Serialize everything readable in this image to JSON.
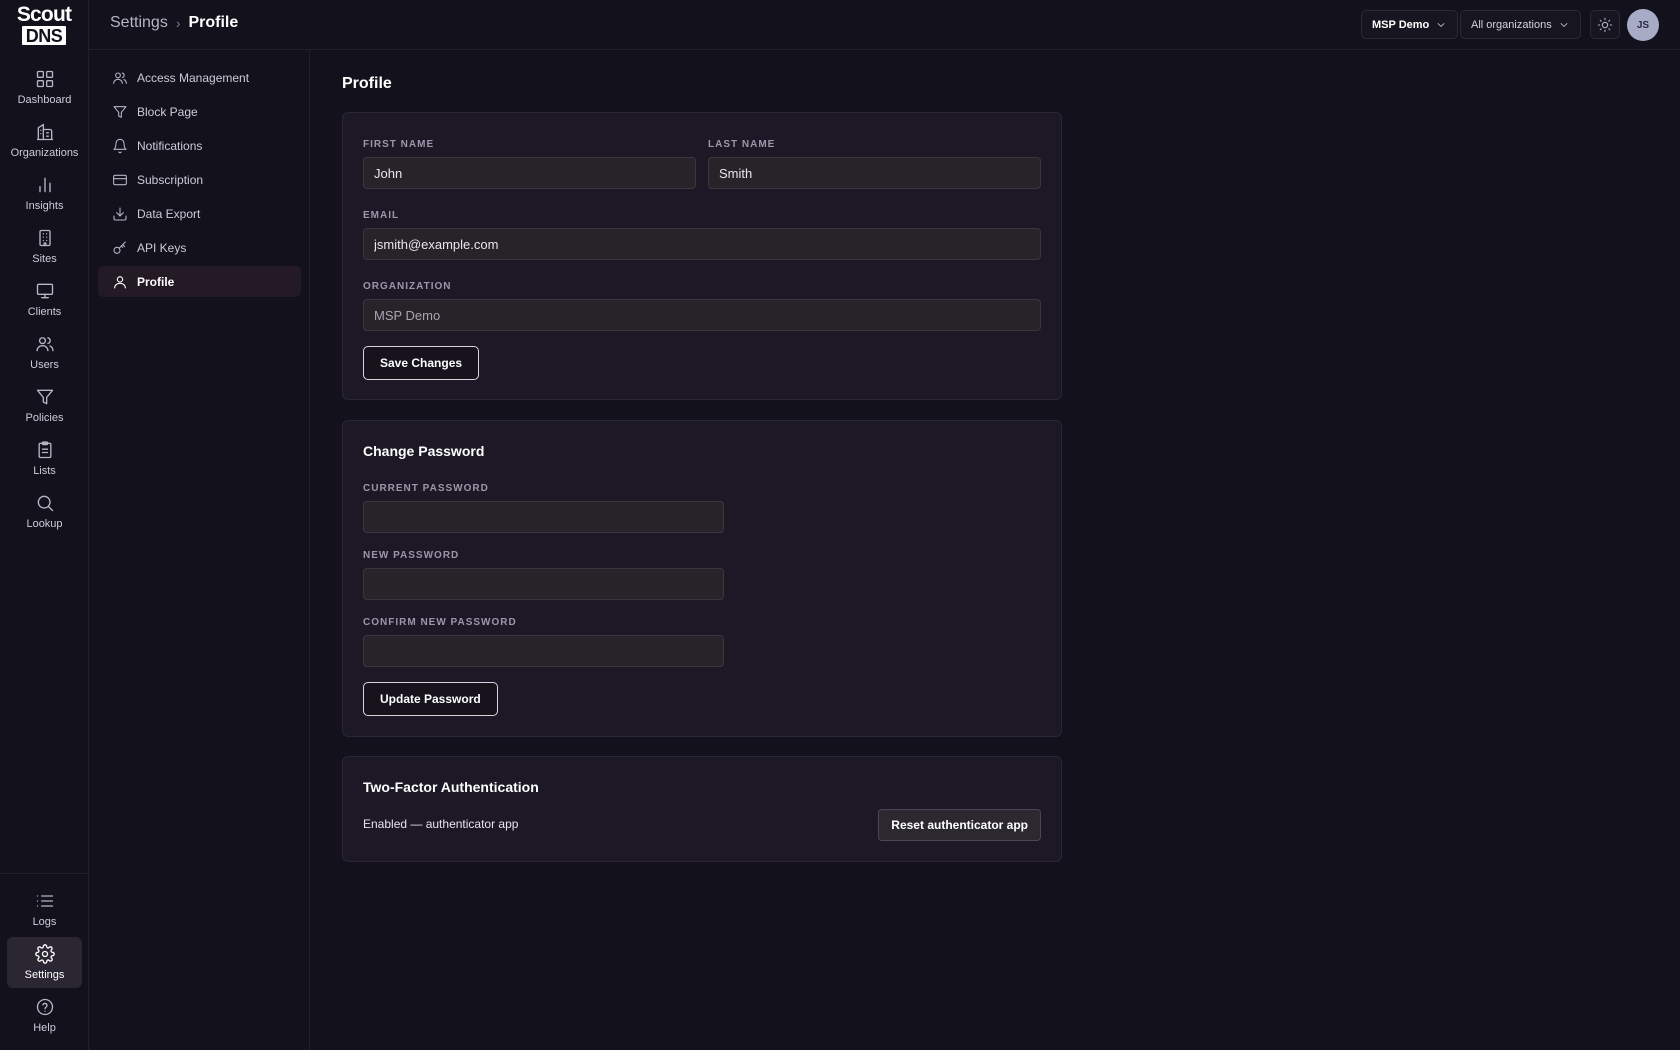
{
  "brand": {
    "line1": "Scout",
    "line2": "DNS"
  },
  "rail": {
    "items": [
      {
        "label": "Dashboard",
        "icon": "grid-icon"
      },
      {
        "label": "Organizations",
        "icon": "building-icon"
      },
      {
        "label": "Insights",
        "icon": "bar-chart-icon"
      },
      {
        "label": "Sites",
        "icon": "office-icon"
      },
      {
        "label": "Clients",
        "icon": "monitor-icon"
      },
      {
        "label": "Users",
        "icon": "users-icon"
      },
      {
        "label": "Policies",
        "icon": "filter-icon"
      },
      {
        "label": "Lists",
        "icon": "clipboard-icon"
      },
      {
        "label": "Lookup",
        "icon": "search-icon"
      }
    ],
    "bottom_items": [
      {
        "label": "Logs",
        "icon": "list-icon"
      },
      {
        "label": "Settings",
        "icon": "gear-icon",
        "active": true
      },
      {
        "label": "Help",
        "icon": "help-icon"
      }
    ]
  },
  "header": {
    "breadcrumb_parent": "Settings",
    "breadcrumb_separator": "›",
    "breadcrumb_current": "Profile",
    "org_selector": "MSP Demo",
    "scope_selector": "All organizations",
    "theme_icon": "sun-icon",
    "avatar_initials": "JS"
  },
  "settings_nav": {
    "items": [
      {
        "label": "Access Management",
        "icon": "users-icon"
      },
      {
        "label": "Block Page",
        "icon": "filter-icon"
      },
      {
        "label": "Notifications",
        "icon": "bell-icon"
      },
      {
        "label": "Subscription",
        "icon": "credit-card-icon"
      },
      {
        "label": "Data Export",
        "icon": "download-icon"
      },
      {
        "label": "API Keys",
        "icon": "key-icon"
      },
      {
        "label": "Profile",
        "icon": "user-icon",
        "active": true
      }
    ]
  },
  "profile": {
    "title": "Profile",
    "first_name_label": "FIRST NAME",
    "first_name_value": "John",
    "last_name_label": "LAST NAME",
    "last_name_value": "Smith",
    "email_label": "EMAIL",
    "email_value": "jsmith@example.com",
    "organization_label": "ORGANIZATION",
    "organization_value": "MSP Demo",
    "save_button": "Save Changes"
  },
  "password": {
    "title": "Change Password",
    "current_label": "CURRENT PASSWORD",
    "new_label": "NEW PASSWORD",
    "confirm_label": "CONFIRM NEW PASSWORD",
    "update_button": "Update Password"
  },
  "twofa": {
    "title": "Two-Factor Authentication",
    "status": "Enabled — authenticator app",
    "reset_button": "Reset authenticator app"
  }
}
